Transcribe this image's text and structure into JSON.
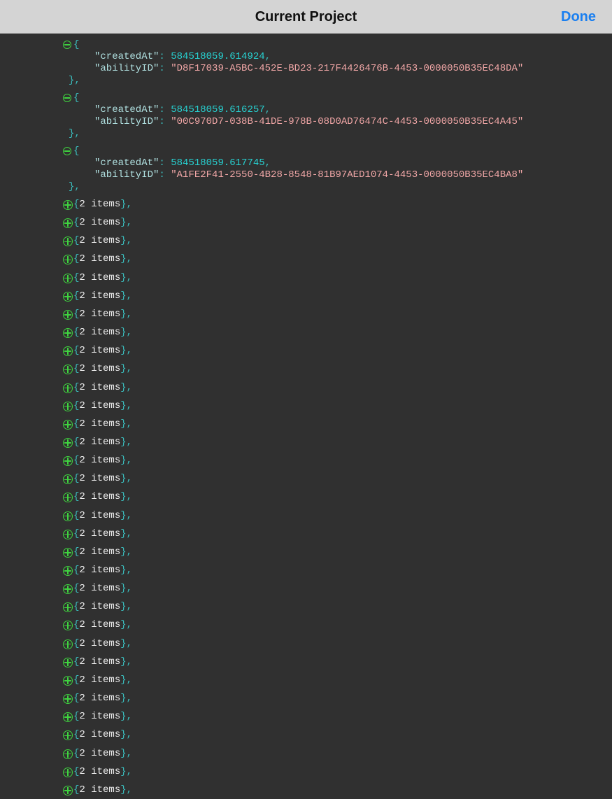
{
  "navbar": {
    "title": "Current Project",
    "done_label": "Done"
  },
  "expanded_items": [
    {
      "key_created": "\"createdAt\"",
      "created_at": "584518059.614924",
      "key_ability": "\"abilityID\"",
      "ability_id": "\"D8F17039-A5BC-452E-BD23-217F4426476B-4453-0000050B35EC48DA\""
    },
    {
      "key_created": "\"createdAt\"",
      "created_at": "584518059.616257",
      "key_ability": "\"abilityID\"",
      "ability_id": "\"00C970D7-038B-41DE-978B-08D0AD76474C-4453-0000050B35EC4A45\""
    },
    {
      "key_created": "\"createdAt\"",
      "created_at": "584518059.617745",
      "key_ability": "\"abilityID\"",
      "ability_id": "\"A1FE2F41-2550-4B28-8548-81B97AED1074-4453-0000050B35EC4BA8\""
    }
  ],
  "collapsed_label": "2 items",
  "collapsed_count": 33,
  "colors": {
    "background": "#303030",
    "navbar": "#d4d4d4",
    "accent": "#1a7ff0",
    "toggle": "#3fd33f",
    "brace": "#3bbfbf",
    "number": "#27d2d2",
    "string": "#f0a6a6"
  },
  "icons": {
    "expanded": "minus-circle-icon",
    "collapsed": "plus-circle-icon"
  }
}
